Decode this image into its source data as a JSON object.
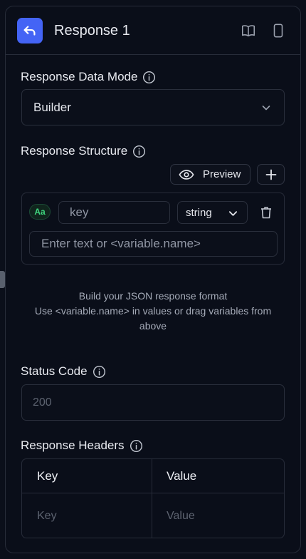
{
  "header": {
    "title": "Response 1",
    "back_icon": "reply-arrow-icon",
    "docs_icon": "book-open-icon",
    "device_icon": "mobile-device-icon",
    "accent_color": "#4464f5"
  },
  "data_mode": {
    "label": "Response Data Mode",
    "selected": "Builder"
  },
  "structure": {
    "label": "Response Structure",
    "preview_label": "Preview",
    "fields": [
      {
        "type_badge": "Aa",
        "key_placeholder": "key",
        "type": "string",
        "value_placeholder": "Enter text or <variable.name>"
      }
    ],
    "help_line1": "Build your JSON response format",
    "help_line2": "Use <variable.name> in values or drag variables from above"
  },
  "status_code": {
    "label": "Status Code",
    "placeholder": "200"
  },
  "response_headers": {
    "label": "Response Headers",
    "columns": [
      "Key",
      "Value"
    ],
    "row_placeholders": [
      "Key",
      "Value"
    ]
  }
}
